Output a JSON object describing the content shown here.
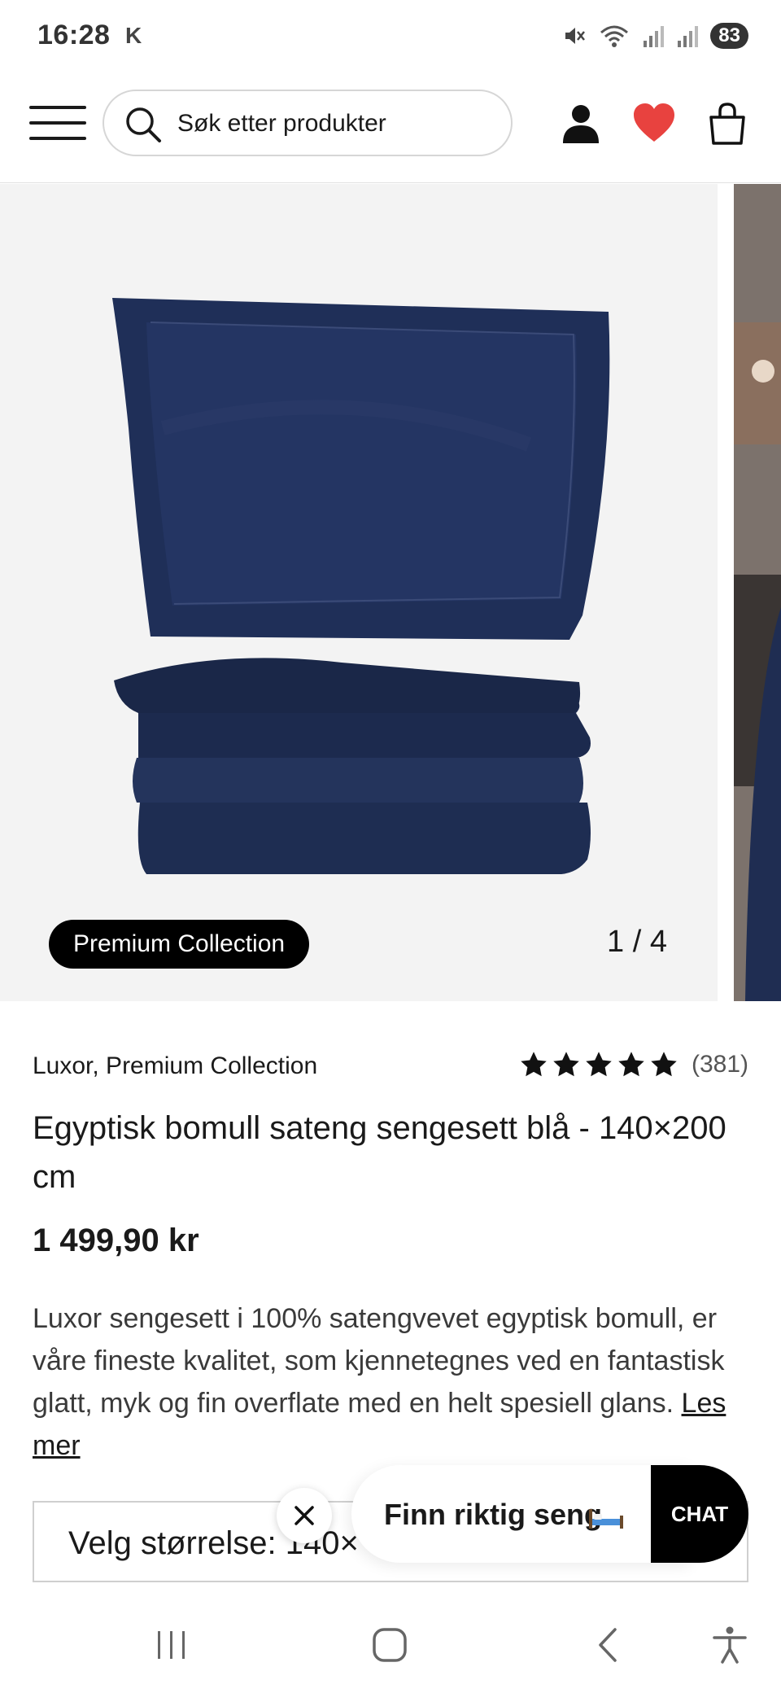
{
  "status_bar": {
    "time": "16:28",
    "carrier_glyph": "K",
    "battery": "83",
    "icons": [
      "mute-icon",
      "wifi-icon",
      "signal-icon",
      "signal-icon",
      "battery-icon"
    ]
  },
  "header": {
    "search_placeholder": "Søk etter produkter",
    "icons": [
      "menu-icon",
      "search-icon",
      "account-icon",
      "heart-icon",
      "bag-icon"
    ],
    "heart_color": "#e8423f"
  },
  "gallery": {
    "badge": "Premium Collection",
    "counter": "1 / 4"
  },
  "product": {
    "brand": "Luxor, Premium Collection",
    "rating_stars": 5,
    "rating_count": "(381)",
    "title": "Egyptisk bomull sateng sengesett blå - 140×200 cm",
    "price": "1 499,90 kr",
    "description": "Luxor sengesett i 100% satengvevet egyptisk bomull, er våre fineste kvalitet, som kjennetegnes ved en fantastisk glatt, myk og fin overflate med en helt spesiell glans.",
    "read_more": "Les mer",
    "size_label": "Velg størrelse: 140×"
  },
  "chat": {
    "prompt": "Finn riktig seng",
    "button": "CHAT"
  },
  "nav_bar": {
    "icons": [
      "recent-apps-icon",
      "home-icon",
      "back-icon",
      "accessibility-icon"
    ]
  },
  "colors": {
    "fabric": "#1f2d52",
    "accent": "#e8423f",
    "badge_bg": "#000000"
  }
}
